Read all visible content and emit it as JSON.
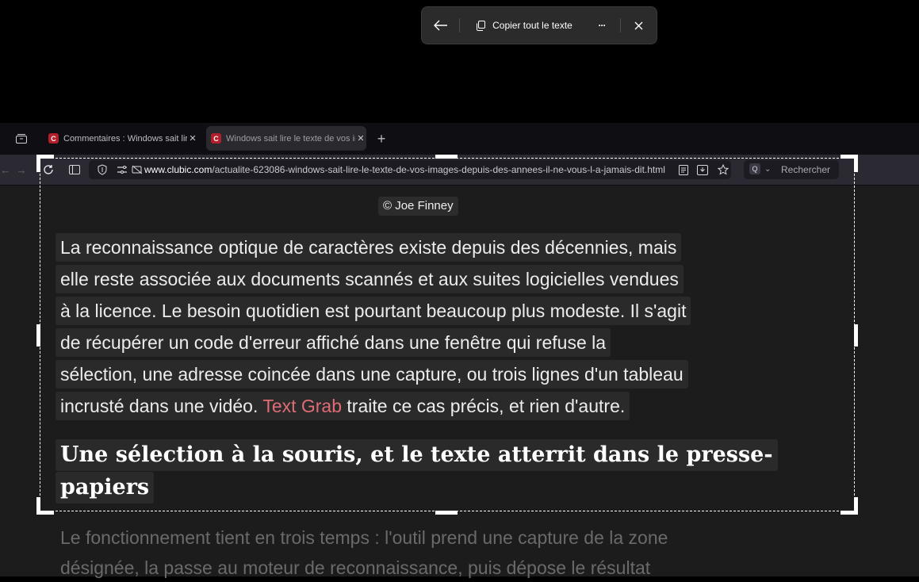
{
  "snip_toolbar": {
    "back_icon": "arrow-left-icon",
    "copy_icon": "copy-icon",
    "copy_label": "Copier tout le texte",
    "more_label": "···",
    "close_icon": "close-icon"
  },
  "tabs": [
    {
      "favicon": "C",
      "title": "Commentaires : Windows sait lire le texte",
      "close": "✕"
    },
    {
      "favicon": "C",
      "title": "Windows sait lire le texte de vos images",
      "close": "✕"
    }
  ],
  "new_tab": "+",
  "url": {
    "domain": "www.clubic.com",
    "path": "/actualite-623086-windows-sait-lire-le-texte-de-vos-images-depuis-des-annees-il-ne-vous-l-a-jamais-dit.html"
  },
  "search_placeholder": "Rechercher",
  "article": {
    "credit": "© Joe Finney",
    "lines": [
      "La reconnaissance optique de caractères existe depuis des décennies, mais",
      "elle reste associée aux documents scannés et aux suites logicielles vendues",
      "à la licence. Le besoin quotidien est pourtant beaucoup plus modeste. Il s'agit",
      "de récupérer un code d'erreur affiché dans une fenêtre qui refuse la",
      "sélection, une adresse coincée dans une capture, ou trois lignes d'un tableau"
    ],
    "last_line_prefix": "incrusté dans une vidéo. ",
    "link_text": "Text Grab",
    "last_line_suffix": " traite ce cas précis, et rien d'autre.",
    "heading_line1": "Une sélection à la souris, et le texte atterrit dans le presse-",
    "heading_line2": "papiers",
    "faded_line1": "Le fonctionnement tient en trois temps : l'outil prend une capture de la zone",
    "faded_line2": "désignée, la passe au moteur de reconnaissance, puis dépose le résultat"
  },
  "colors": {
    "link": "#e06c75",
    "favicon": "#b21f2a"
  }
}
